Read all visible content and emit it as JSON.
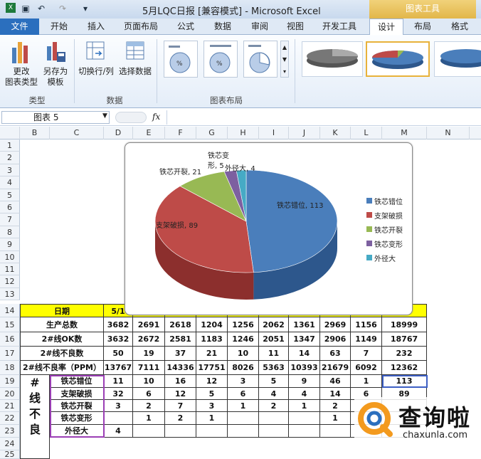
{
  "window": {
    "title": "5月LQC日报  [兼容模式] - Microsoft Excel",
    "context_tools": "图表工具"
  },
  "tabs": [
    "文件",
    "开始",
    "插入",
    "页面布局",
    "公式",
    "数据",
    "审阅",
    "视图",
    "开发工具",
    "设计",
    "布局",
    "格式"
  ],
  "ribbon": {
    "type_group": {
      "label": "类型",
      "change_type": "更改\n图表类型",
      "save_template": "另存为\n模板"
    },
    "data_group": {
      "label": "数据",
      "switch_row_col": "切换行/列",
      "select_data": "选择数据"
    },
    "layout_group": {
      "label": "图表布局"
    }
  },
  "formula_bar": {
    "name_box": "图表 5",
    "fx": "fx",
    "value": ""
  },
  "columns": [
    "B",
    "C",
    "D",
    "E",
    "F",
    "G",
    "H",
    "I",
    "J",
    "K",
    "L",
    "M",
    "N"
  ],
  "rows": [
    "1",
    "2",
    "3",
    "4",
    "5",
    "6",
    "7",
    "8",
    "9",
    "10",
    "11",
    "12",
    "13",
    "14",
    "15",
    "16",
    "17",
    "18",
    "19",
    "20",
    "21",
    "22",
    "23",
    "24",
    "25"
  ],
  "table": {
    "date_label": "日期",
    "date_first": "5/1",
    "rows": [
      {
        "label": "生产总数",
        "values": [
          "3682",
          "2691",
          "2618",
          "1204",
          "1256",
          "2062",
          "1361",
          "2969",
          "1156",
          "18999"
        ]
      },
      {
        "label": "2#线OK数",
        "values": [
          "3632",
          "2672",
          "2581",
          "1183",
          "1246",
          "2051",
          "1347",
          "2906",
          "1149",
          "18767"
        ]
      },
      {
        "label": "2#线不良数",
        "values": [
          "50",
          "19",
          "37",
          "21",
          "10",
          "11",
          "14",
          "63",
          "7",
          "232"
        ]
      },
      {
        "label": "2#线不良率（PPM）",
        "values": [
          "13767",
          "7111",
          "14336",
          "17751",
          "8026",
          "5363",
          "10393",
          "21679",
          "6092",
          "12362"
        ]
      }
    ],
    "side_label": "#\n线\n不\n良",
    "defects": [
      {
        "label": "铁芯错位",
        "values": [
          "11",
          "10",
          "16",
          "12",
          "3",
          "5",
          "9",
          "46",
          "1",
          "113"
        ]
      },
      {
        "label": "支架破损",
        "values": [
          "32",
          "6",
          "12",
          "5",
          "6",
          "4",
          "4",
          "14",
          "6",
          "89"
        ]
      },
      {
        "label": "铁芯开裂",
        "values": [
          "3",
          "2",
          "7",
          "3",
          "1",
          "2",
          "1",
          "2",
          "",
          ""
        ]
      },
      {
        "label": "铁芯变形",
        "values": [
          "",
          "1",
          "2",
          "1",
          "",
          "",
          "",
          "1",
          "",
          ""
        ]
      },
      {
        "label": "外径大",
        "values": [
          "4",
          "",
          "",
          "",
          "",
          "",
          "",
          "",
          "",
          ""
        ]
      }
    ]
  },
  "chart_data": {
    "type": "pie",
    "categories": [
      "铁芯错位",
      "支架破损",
      "铁芯开裂",
      "铁芯变形",
      "外径大"
    ],
    "values": [
      113,
      89,
      21,
      5,
      4
    ],
    "data_labels": [
      "铁芯错位, 113",
      "支架破损, 89",
      "铁芯开裂, 21",
      "铁芯变\n形, 5",
      "外径大, 4"
    ],
    "colors": [
      "#4a7ebb",
      "#be4b48",
      "#98b954",
      "#7d60a0",
      "#46aac5"
    ],
    "side_colors": [
      "#2d578c",
      "#8c2f2d",
      "#6f8a37",
      "#5a4277",
      "#2e7e94"
    ],
    "legend_position": "right",
    "style": "3d"
  },
  "watermark": {
    "brand": "查询啦",
    "url": "chaxunla.com"
  }
}
